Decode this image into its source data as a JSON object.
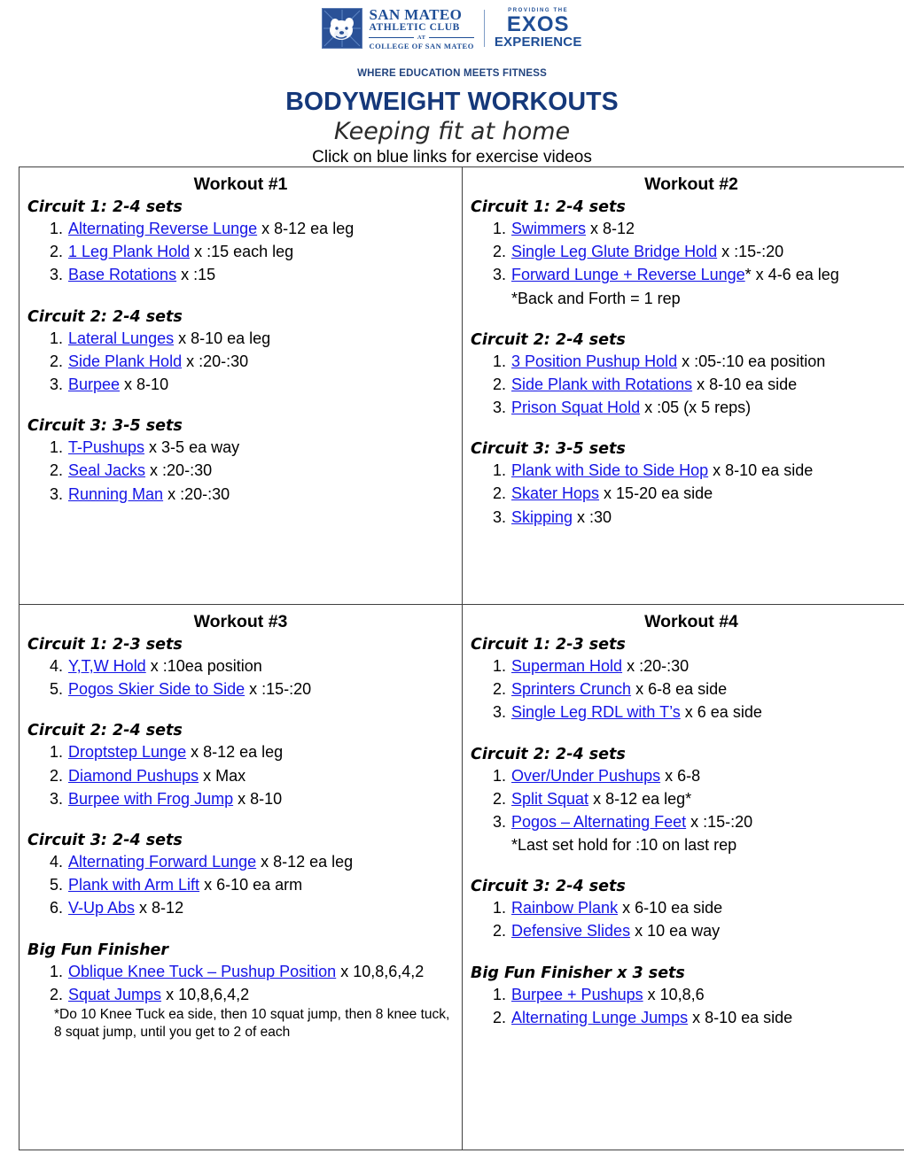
{
  "header": {
    "logo": {
      "club_line1": "SAN MATEO",
      "club_line2": "ATHLETIC CLUB",
      "club_at": "AT",
      "club_line4": "COLLEGE OF SAN MATEO",
      "exos_pre": "PROVIDING THE",
      "exos_main": "EXOS",
      "exos_sub": "EXPERIENCE"
    },
    "tagline": "WHERE EDUCATION MEETS FITNESS",
    "title": "BODYWEIGHT WORKOUTS",
    "subtitle": "Keeping fit at home",
    "note": "Click on blue links for exercise videos"
  },
  "colors": {
    "title_blue": "#15387a",
    "tagline_blue": "#22447f",
    "link_blue": "#1414e6",
    "logo_blue": "#1f4e96",
    "table_border": "#404040"
  },
  "workouts": [
    {
      "title": "Workout #1",
      "blocks": [
        {
          "heading": "Circuit 1:  2-4 sets",
          "items": [
            {
              "num": "1.",
              "link": "Alternating Reverse Lunge",
              "rest": " x 8-12 ea leg"
            },
            {
              "num": "2.",
              "link": "1 Leg Plank Hold",
              "rest": " x :15 each leg"
            },
            {
              "num": "3.",
              "link": "Base Rotations",
              "rest": " x :15"
            }
          ]
        },
        {
          "heading": "Circuit 2:  2-4 sets",
          "items": [
            {
              "num": "1.",
              "link": "Lateral Lunges",
              "rest": " x 8-10 ea leg"
            },
            {
              "num": "2.",
              "link": "Side Plank Hold",
              "rest": " x :20-:30"
            },
            {
              "num": "3.",
              "link": "Burpee",
              "rest": " x 8-10"
            }
          ]
        },
        {
          "heading": "Circuit 3:  3-5 sets",
          "items": [
            {
              "num": "1.",
              "link": "T-Pushups",
              "rest": " x 3-5 ea way"
            },
            {
              "num": "2.",
              "link": "Seal Jacks",
              "rest": " x :20-:30"
            },
            {
              "num": "3.",
              "link": "Running Man",
              "rest": " x :20-:30"
            }
          ]
        }
      ]
    },
    {
      "title": "Workout #2",
      "blocks": [
        {
          "heading": "Circuit 1:  2-4 sets",
          "items": [
            {
              "num": "1.",
              "link": "Swimmers",
              "rest": " x 8-12"
            },
            {
              "num": "2.",
              "link": "Single Leg Glute Bridge Hold",
              "rest": " x :15-:20"
            },
            {
              "num": "3.",
              "link": "Forward Lunge + Reverse Lunge",
              "rest": "* x 4-6 ea leg"
            }
          ],
          "note": "*Back and Forth = 1 rep"
        },
        {
          "heading": "Circuit 2:  2-4 sets",
          "items": [
            {
              "num": "1.",
              "link": "3 Position Pushup Hold",
              "rest": " x :05-:10 ea position"
            },
            {
              "num": "2.",
              "link": "Side Plank with Rotations",
              "rest": " x 8-10 ea side"
            },
            {
              "num": "3.",
              "link": "Prison Squat Hold",
              "rest": " x :05 (x 5 reps)"
            }
          ]
        },
        {
          "heading": "Circuit 3:  3-5 sets",
          "items": [
            {
              "num": "1.",
              "link": "Plank with Side to Side Hop",
              "rest": " x 8-10 ea side"
            },
            {
              "num": "2.",
              "link": "Skater Hops",
              "rest": " x 15-20 ea side"
            },
            {
              "num": "3.",
              "link": "Skipping",
              "rest": " x :30"
            }
          ]
        }
      ]
    },
    {
      "title": "Workout #3",
      "blocks": [
        {
          "heading": "Circuit 1:  2-3 sets",
          "items": [
            {
              "num": "4.",
              "link": "Y,T,W Hold",
              "rest": " x :10ea position"
            },
            {
              "num": "5.",
              "link": "Pogos Skier Side to Side",
              "rest": " x :15-:20"
            }
          ]
        },
        {
          "heading": "Circuit 2:  2-4 sets",
          "items": [
            {
              "num": "1.",
              "link": "Droptstep Lunge",
              "rest": " x 8-12 ea leg"
            },
            {
              "num": "2.",
              "link": "Diamond Pushups",
              "rest": " x Max"
            },
            {
              "num": "3.",
              "link": "Burpee with Frog Jump",
              "rest": " x 8-10"
            }
          ]
        },
        {
          "heading": "Circuit 3:  2-4 sets",
          "items": [
            {
              "num": "4.",
              "link": "Alternating Forward Lunge",
              "rest": " x 8-12 ea leg"
            },
            {
              "num": "5.",
              "link": "Plank with Arm Lift",
              "rest": " x 6-10 ea arm"
            },
            {
              "num": "6.",
              "link": "V-Up Abs",
              "rest": " x 8-12"
            }
          ]
        },
        {
          "heading": "Big Fun Finisher",
          "items": [
            {
              "num": "1.",
              "link": "Oblique Knee Tuck – Pushup Position",
              "rest": " x 10,8,6,4,2"
            },
            {
              "num": "2.",
              "link": "Squat Jumps",
              "rest": " x 10,8,6,4,2"
            }
          ],
          "small_note": "*Do 10 Knee Tuck ea side, then 10 squat jump, then 8 knee tuck, 8 squat jump, until you get to 2 of each"
        }
      ]
    },
    {
      "title": "Workout #4",
      "blocks": [
        {
          "heading": "Circuit 1:  2-3 sets",
          "items": [
            {
              "num": "1.",
              "link": "Superman Hold",
              "rest": " x :20-:30"
            },
            {
              "num": "2.",
              "link": "Sprinters Crunch",
              "rest": " x 6-8 ea side"
            },
            {
              "num": "3.",
              "link": "Single Leg RDL with T’s",
              "rest": " x 6 ea side"
            }
          ]
        },
        {
          "heading": "Circuit 2:  2-4 sets",
          "items": [
            {
              "num": "1.",
              "link": "Over/Under Pushups",
              "rest": " x 6-8"
            },
            {
              "num": "2.",
              "link": "Split Squat",
              "rest": " x 8-12 ea leg*"
            },
            {
              "num": "3.",
              "link": "Pogos – Alternating Feet",
              "rest": " x :15-:20"
            }
          ],
          "note": "*Last set hold for :10 on last rep"
        },
        {
          "heading": "Circuit 3:  2-4 sets",
          "items": [
            {
              "num": "1.",
              "link": "Rainbow Plank",
              "rest": " x 6-10 ea side"
            },
            {
              "num": "2.",
              "link": "Defensive Slides",
              "rest": " x 10 ea way"
            }
          ]
        },
        {
          "heading": "Big Fun Finisher x 3 sets",
          "items": [
            {
              "num": "1.",
              "link": "Burpee + Pushups",
              "rest": " x 10,8,6"
            },
            {
              "num": "2.",
              "link": "Alternating Lunge Jumps",
              "rest": " x 8-10 ea side"
            }
          ]
        }
      ]
    }
  ]
}
